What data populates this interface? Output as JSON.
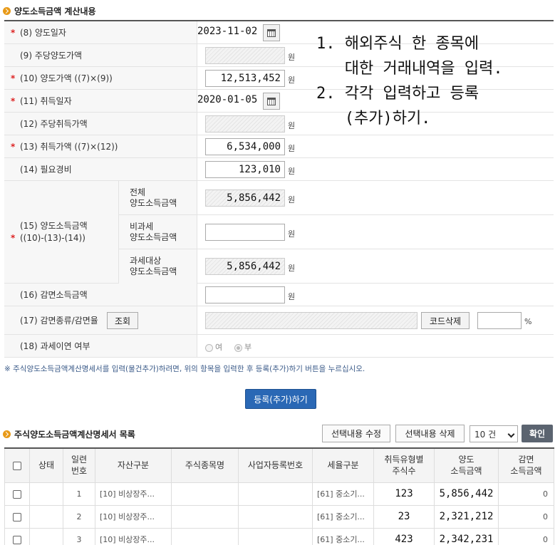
{
  "section1": {
    "title": "양도소득금액 계산내용"
  },
  "fields": {
    "f8": {
      "label": "(8) 양도일자",
      "value": "2023-11-02"
    },
    "f9": {
      "label": "(9) 주당양도가액",
      "unit": "원"
    },
    "f10": {
      "label": "(10) 양도가액 ((7)×(9))",
      "value": "12,513,452",
      "unit": "원"
    },
    "f11": {
      "label": "(11) 취득일자",
      "value": "2020-01-05"
    },
    "f12": {
      "label": "(12) 주당취득가액",
      "unit": "원"
    },
    "f13": {
      "label": "(13) 취득가액 ((7)×(12))",
      "value": "6,534,000",
      "unit": "원"
    },
    "f14": {
      "label": "(14) 필요경비",
      "value": "123,010",
      "unit": "원"
    },
    "f15": {
      "label_line1": "(15) 양도소득금액",
      "label_line2": "((10)-(13)-(14))",
      "total": {
        "label_line1": "전체",
        "label_line2": "양도소득금액",
        "value": "5,856,442",
        "unit": "원"
      },
      "nontax": {
        "label_line1": "비과세",
        "label_line2": "양도소득금액",
        "value": "",
        "unit": "원"
      },
      "taxable": {
        "label_line1": "과세대상",
        "label_line2": "양도소득금액",
        "value": "5,856,442",
        "unit": "원"
      }
    },
    "f16": {
      "label": "(16) 감면소득금액",
      "unit": "원"
    },
    "f17": {
      "label": "(17) 감면종류/감면율",
      "lookup_button": "조회",
      "delete_code_button": "코드삭제",
      "percent_unit": "%"
    },
    "f18": {
      "label": "(18) 과세이연 여부",
      "option_yes": "여",
      "option_no": "부",
      "selected": "부"
    }
  },
  "required_mark": "*",
  "annotation": {
    "line1": "1. 해외주식 한 종목에",
    "line2": "   대한 거래내역을 입력.",
    "line3": "2. 각각 입력하고 등록",
    "line4": "   (추가)하기."
  },
  "notice": "※ 주식양도소득금액계산명세서를 입력(물건추가)하려면, 위의 항목을 입력한 후 등록(추가)하기 버튼을 누르십시오.",
  "register_button": "등록(추가)하기",
  "section2": {
    "title": "주식양도소득금액계산명세서 목록",
    "edit_button": "선택내용 수정",
    "delete_button": "선택내용 삭제",
    "count_select": "10 건",
    "confirm_button": "확인"
  },
  "table": {
    "headers": {
      "status": "상태",
      "seq_l1": "일련",
      "seq_l2": "번호",
      "asset": "자산구분",
      "stock": "주식종목명",
      "bizno": "사업자등록번호",
      "taxtype": "세율구분",
      "qty_l1": "취득유형별",
      "qty_l2": "주식수",
      "gain_l1": "양도",
      "gain_l2": "소득금액",
      "exempt_l1": "감면",
      "exempt_l2": "소득금액"
    },
    "rows": [
      {
        "seq": "1",
        "asset": "[10] 비상장주...",
        "stock": "",
        "bizno": "",
        "taxtype": "[61] 중소기...",
        "qty": "123",
        "gain": "5,856,442",
        "exempt": "0"
      },
      {
        "seq": "2",
        "asset": "[10] 비상장주...",
        "stock": "",
        "bizno": "",
        "taxtype": "[61] 중소기...",
        "qty": "23",
        "gain": "2,321,212",
        "exempt": "0"
      },
      {
        "seq": "3",
        "asset": "[10] 비상장주...",
        "stock": "",
        "bizno": "",
        "taxtype": "[61] 중소기...",
        "qty": "423",
        "gain": "2,342,231",
        "exempt": "0"
      }
    ]
  }
}
